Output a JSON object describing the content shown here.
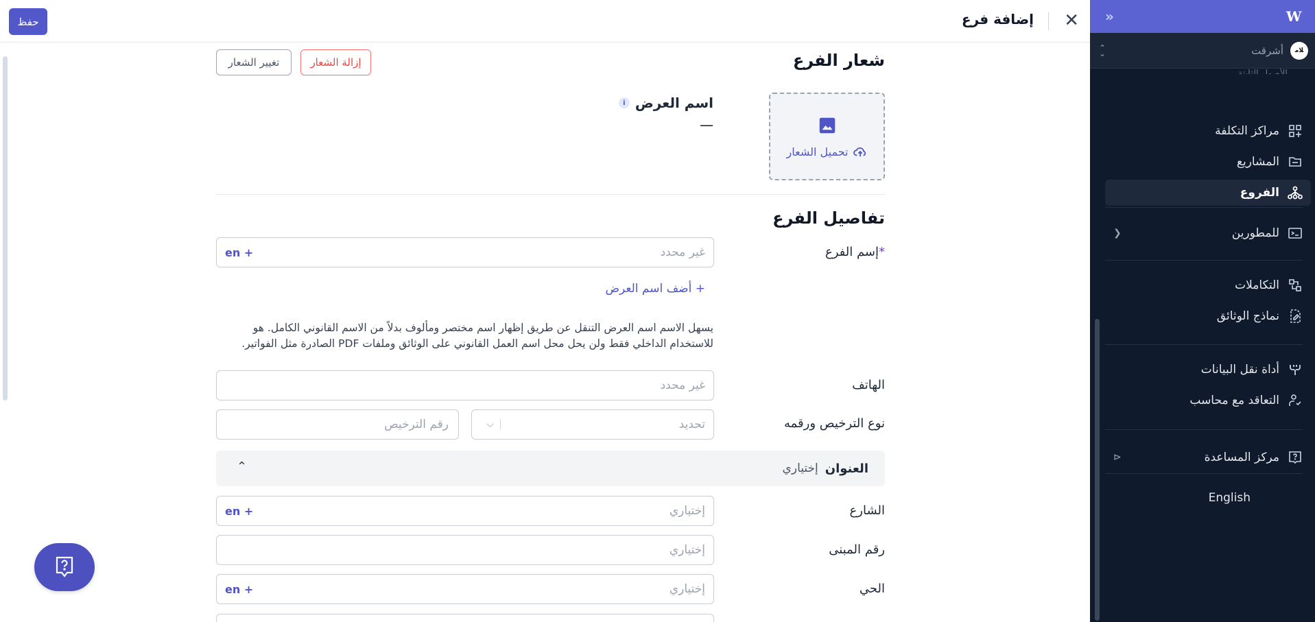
{
  "header": {
    "title": "إضافة فرع",
    "save_label": "حفظ"
  },
  "logo_section": {
    "title": "شعار الفرع",
    "remove_label": "إزالة الشعار",
    "change_label": "تغيير الشعار",
    "upload_label": "تحميل الشعار",
    "display_name_label": "اسم العرض",
    "display_name_value": "—"
  },
  "details": {
    "title": "تفاصيل الفرع",
    "branch_name_label": "إسم الفرع",
    "branch_name_placeholder": "غير محدد",
    "lang_tag": "en +",
    "add_display_name": "+ أضف اسم العرض",
    "help_line1": "يسهل الاسم اسم العرض التنقل عن طريق إظهار اسم مختصر ومألوف بدلاً من الاسم القانوني الكامل. هو",
    "help_line2": "للاستخدام الداخلي فقط ولن يحل محل اسم العمل القانوني على الوثائق وملفات PDF الصادرة مثل الفواتير.",
    "phone_label": "الهاتف",
    "phone_placeholder": "غير محدد",
    "license_label": "نوع الترخيص ورقمه",
    "license_type_placeholder": "تحديد",
    "license_number_placeholder": "رقم الترخيص"
  },
  "address": {
    "title": "العنوان",
    "optional": "إختياري",
    "street_label": "الشارع",
    "street_placeholder": "إختياري",
    "building_label": "رقم المبنى",
    "building_placeholder": "إختياري",
    "district_label": "الحي",
    "district_placeholder": "إختياري",
    "lang_tag": "en +"
  },
  "sidebar": {
    "org_name": "أشرقت",
    "org_avatar": "ﻼﻣ",
    "partial_item": "الأصول الثابتة",
    "items": [
      {
        "label": "مراكز التكلفة",
        "icon": "grid-plus-icon"
      },
      {
        "label": "المشاريع",
        "icon": "folder-icon"
      },
      {
        "label": "الفروع",
        "icon": "branches-icon",
        "active": true
      },
      {
        "label": "للمطورين",
        "icon": "terminal-icon"
      },
      {
        "label": "التكاملات",
        "icon": "integrations-icon"
      },
      {
        "label": "نماذج الوثائق",
        "icon": "document-template-icon"
      },
      {
        "label": "أداة نقل البيانات",
        "icon": "data-migration-icon"
      },
      {
        "label": "التعاقد مع محاسب",
        "icon": "accountant-icon"
      },
      {
        "label": "مركز المساعدة",
        "icon": "help-center-icon"
      }
    ],
    "language_switch": "English"
  },
  "colors": {
    "primary": "#5258c9",
    "sidebar_bg": "#0f1b2d",
    "sidebar_top": "#5b63d3",
    "danger": "#ef4444"
  }
}
